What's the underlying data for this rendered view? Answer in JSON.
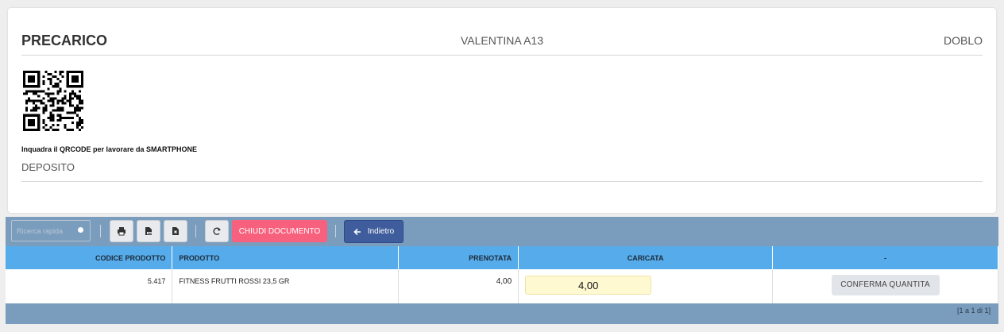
{
  "header": {
    "title": "PRECARICO",
    "center": "VALENTINA A13",
    "right": "DOBLO"
  },
  "qr": {
    "caption": "Inquadra il QRCODE per lavorare da SMARTPHONE"
  },
  "deposito": "DEPOSITO",
  "toolbar": {
    "search_placeholder": "Ricerca rapida",
    "print_icon": "print-icon",
    "pdf_icon": "pdf-icon",
    "excel_icon": "excel-icon",
    "refresh_icon": "refresh-icon",
    "chiudi_label": "CHIUDI DOCUMENTO",
    "indietro_label": "Indietro"
  },
  "table": {
    "headers": [
      "CODICE PRODOTTO",
      "PRODOTTO",
      "PRENOTATA",
      "CARICATA",
      "-"
    ],
    "rows": [
      {
        "codice": "5.417",
        "prodotto": "FITNESS FRUTTI ROSSI 23,5 GR",
        "prenotata": "4,00",
        "caricata": "4,00",
        "action": "CONFERMA QUANTITA"
      }
    ]
  },
  "pager": "[1 a 1 di 1]",
  "colors": {
    "header_blue": "#56acea",
    "grid_bg": "#7a9cbd",
    "chiudi_pink": "#f8617e",
    "indietro_navy": "#3f5d9c",
    "input_yellow": "#fff9d2"
  }
}
